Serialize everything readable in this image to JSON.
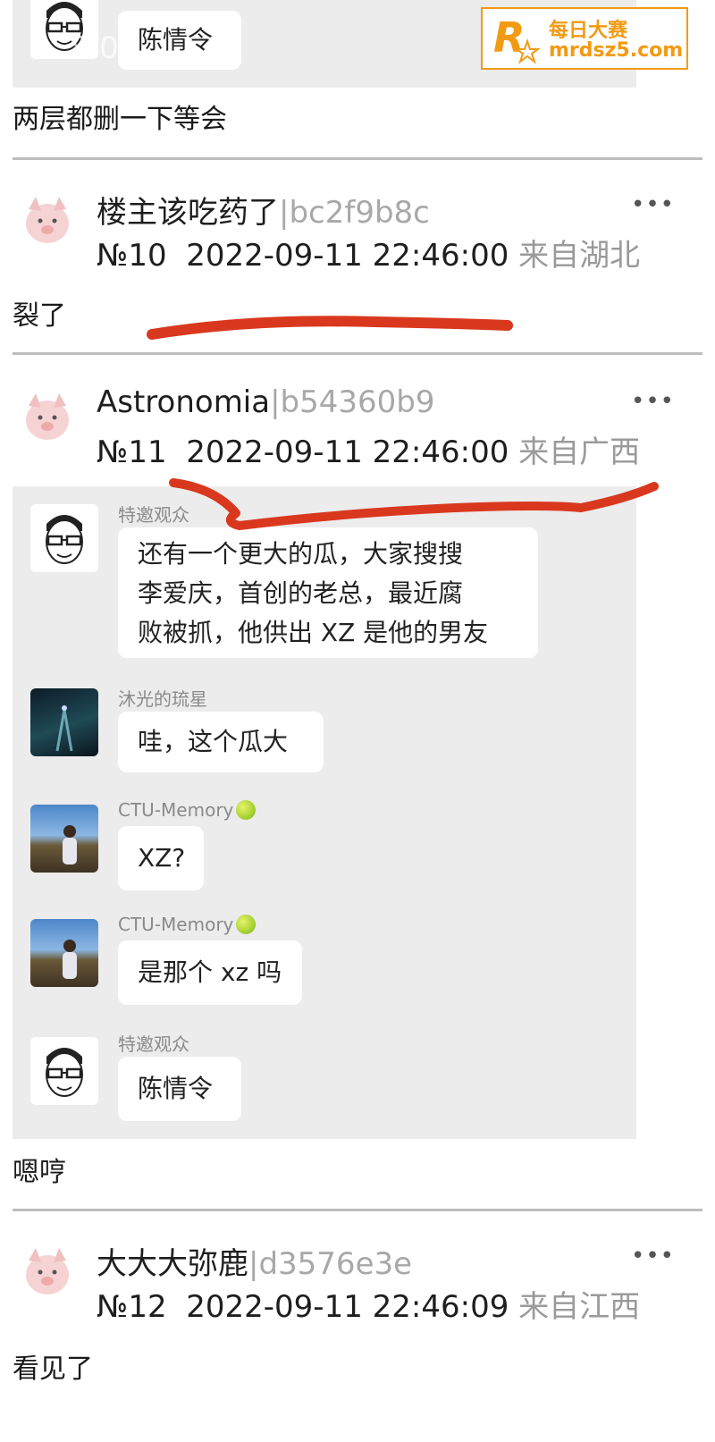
{
  "watermark": {
    "brand": "每日大赛",
    "url": "mrdsz5.com",
    "logo_letter": "R"
  },
  "top_fragment": {
    "time_ghost": "8:0",
    "bubble": "陈情令",
    "reply": "两层都删一下等会"
  },
  "posts": [
    {
      "name": "楼主该吃药了",
      "uid": "|bc2f9b8c",
      "floor": "№10",
      "time": "2022-09-11 22:46:00",
      "location": "来自湖北",
      "reply": "裂了",
      "more": "•••"
    },
    {
      "name": "Astronomia",
      "uid": "|b54360b9",
      "floor": "№11",
      "time": "2022-09-11 22:46:00",
      "location": "来自广西",
      "reply": "嗯哼",
      "more": "•••"
    },
    {
      "name": "大大大弥鹿",
      "uid": "|d3576e3e",
      "floor": "№12",
      "time": "2022-09-11 22:46:09",
      "location": "来自江西",
      "reply": "看见了",
      "more": "•••"
    }
  ],
  "quoted_chat": [
    {
      "sender": "特邀观众",
      "lines": [
        "还有一个更大的瓜，大家搜搜",
        "李爱庆，首创的老总，最近腐",
        "败被抓，他供出 XZ 是他的男友"
      ]
    },
    {
      "sender": "沐光的琉星",
      "lines": [
        "哇，这个瓜大"
      ]
    },
    {
      "sender": "CTU-Memory",
      "lines": [
        "XZ?"
      ]
    },
    {
      "sender": "CTU-Memory",
      "lines": [
        "是那个 xz 吗"
      ]
    },
    {
      "sender": "特邀观众",
      "lines": [
        "陈情令"
      ]
    }
  ],
  "colors": {
    "annotation_red": "#d9381e",
    "quote_panel": "#ececec",
    "watermark_orange": "#f29a12"
  }
}
